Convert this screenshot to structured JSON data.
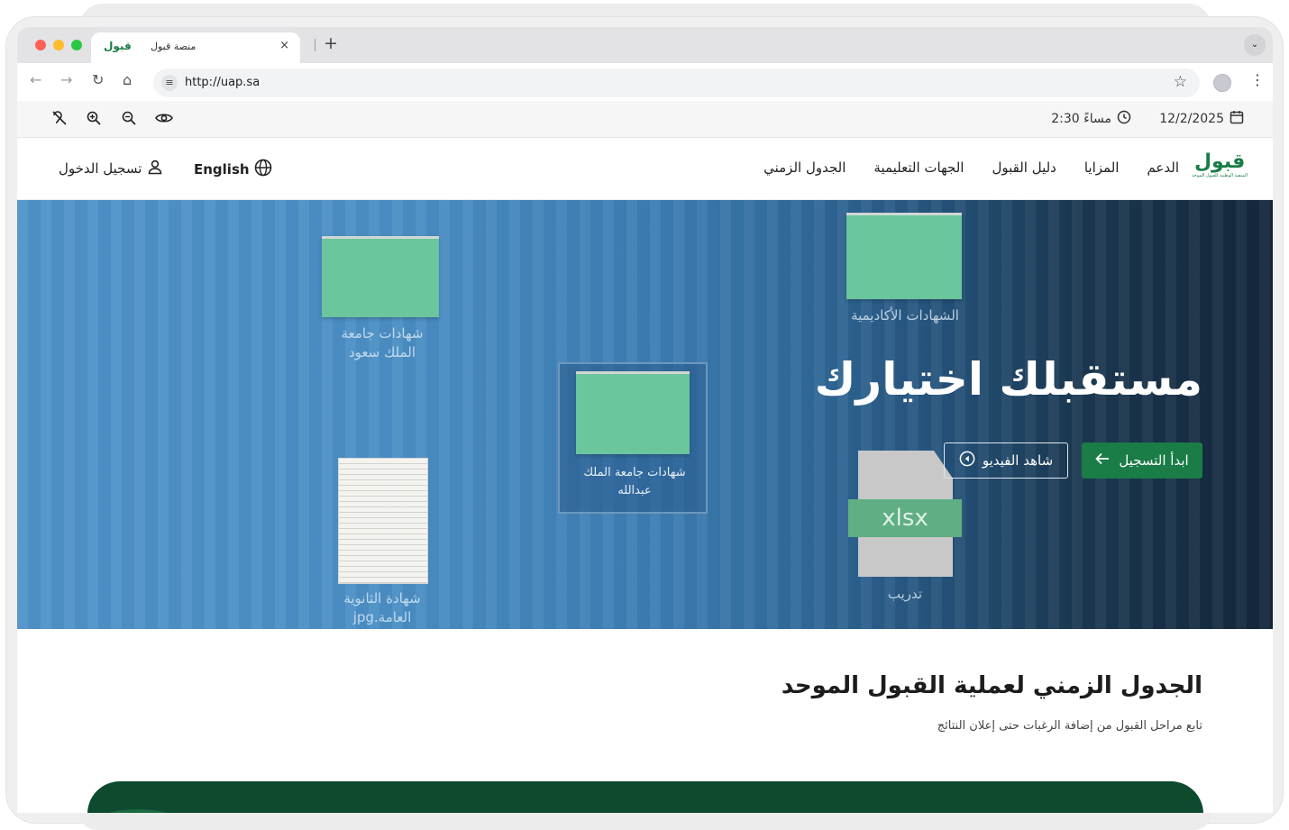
{
  "browser": {
    "tab_logo": "قبول",
    "tab_title": "منصة قبول",
    "tab_close": "×",
    "new_tab": "+",
    "tab_menu": "⌄",
    "url": "http://uap.sa"
  },
  "utility_bar": {
    "date": "12/2/2025",
    "time": "2:30 مساءً"
  },
  "nav": {
    "brand": "قبول",
    "brand_sub": "المنصة الوطنية للقبول الموحد",
    "links": [
      "الجدول الزمني",
      "الجهات التعليمية",
      "دليل القبول",
      "المزايا",
      "الدعم"
    ],
    "language": "English",
    "login": "تسجيل الدخول"
  },
  "hero": {
    "title": "مستقبلك اختيارك",
    "primary_cta": "ابدأ التسجيل",
    "secondary_cta": "شاهد الفيديو",
    "folder_labels": {
      "ksu": "شهادات جامعة\nالملك سعود",
      "academic": "الشهادات الأكاديمية",
      "selected": "شهادات جامعة الملك\nعبدالله",
      "secondary": "شهادة الثانوية\nالعامة.jpg",
      "training": "تدريب",
      "xlsx": "xlsx"
    }
  },
  "timeline": {
    "title": "الجدول الزمني لعملية القبول الموحد",
    "subtitle": "تابع مراحل القبول من إضافة الرغبات حتى إعلان النتائج"
  },
  "colors": {
    "brand_green": "#1a7c47",
    "timeline_card": "#0d4a2e",
    "hero_dark": "#13263a"
  }
}
